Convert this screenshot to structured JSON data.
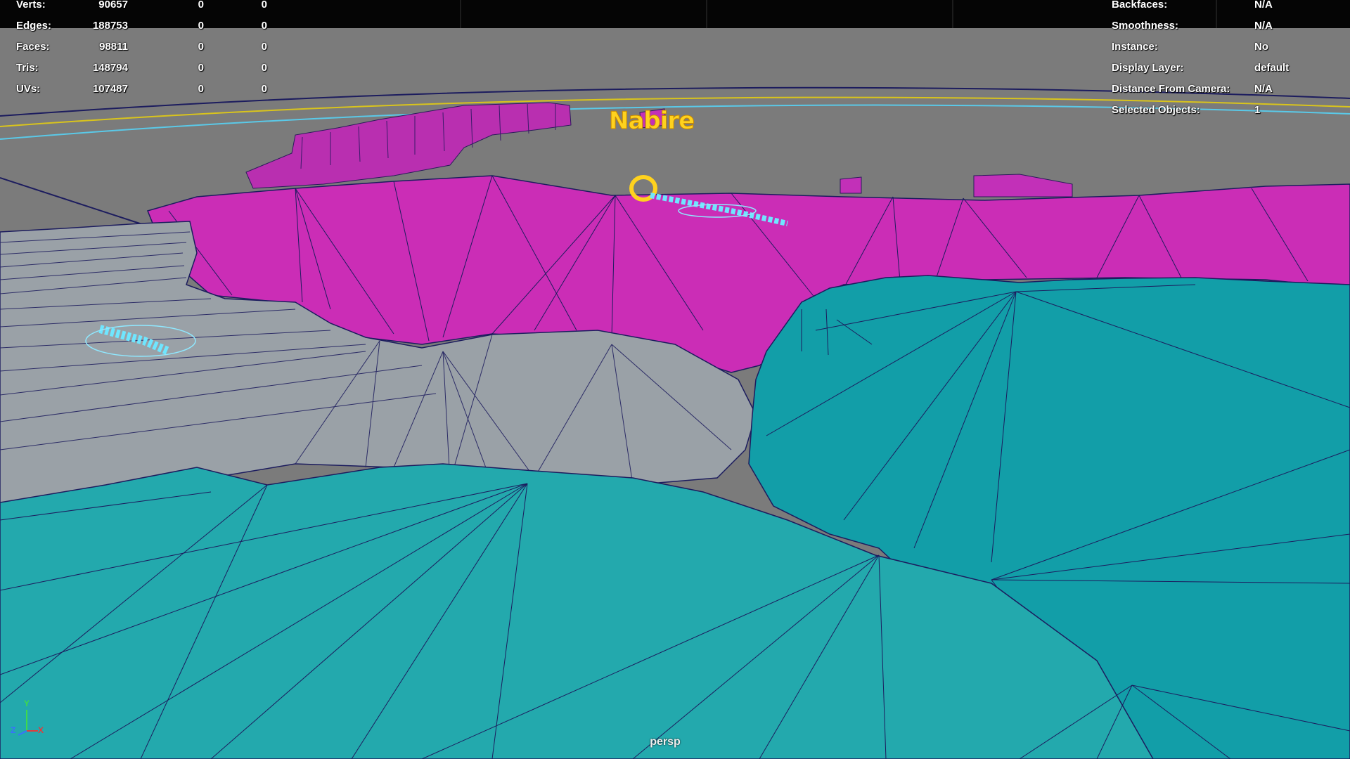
{
  "viewport": {
    "camera": "persp",
    "colors": {
      "background": "#7b7b7b",
      "magenta_mesh": "#cc2fb8",
      "teal_mesh": "#1fa7ad",
      "grey_mesh": "#9aa1a7",
      "wireframe": "#1c1c5e",
      "selection_cyan": "#6fe6ff",
      "highlight_yellow": "#ffd21e"
    },
    "scene_label": "Nabire"
  },
  "poly_count": {
    "rows": [
      {
        "label": "Verts:",
        "total": "90657",
        "selected": "0",
        "third": "0"
      },
      {
        "label": "Edges:",
        "total": "188753",
        "selected": "0",
        "third": "0"
      },
      {
        "label": "Faces:",
        "total": "98811",
        "selected": "0",
        "third": "0"
      },
      {
        "label": "Tris:",
        "total": "148794",
        "selected": "0",
        "third": "0"
      },
      {
        "label": "UVs:",
        "total": "107487",
        "selected": "0",
        "third": "0"
      }
    ]
  },
  "object_details": {
    "rows": [
      {
        "label": "Backfaces:",
        "value": "N/A"
      },
      {
        "label": "Smoothness:",
        "value": "N/A"
      },
      {
        "label": "Instance:",
        "value": "No"
      },
      {
        "label": "Display Layer:",
        "value": "default"
      },
      {
        "label": "Distance From Camera:",
        "value": "N/A"
      },
      {
        "label": "Selected Objects:",
        "value": "1"
      }
    ]
  },
  "axis_gizmo": {
    "x": "X",
    "y": "Y",
    "z": "Z"
  }
}
